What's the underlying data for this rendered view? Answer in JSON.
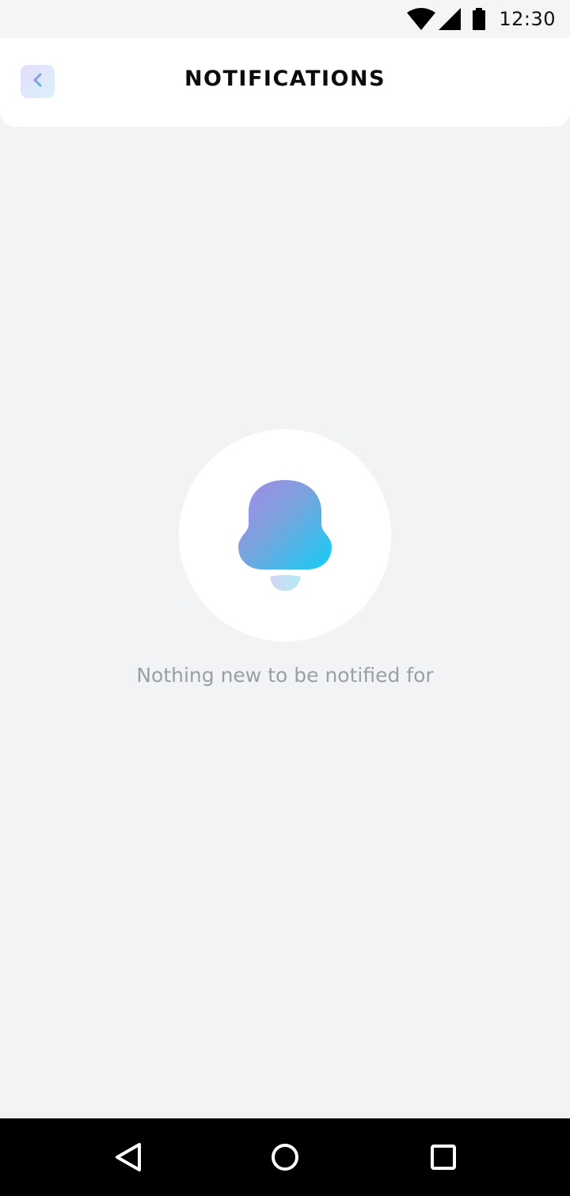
{
  "status_bar": {
    "time": "12:30",
    "icons": [
      "wifi-icon",
      "cellular-signal-icon",
      "battery-icon"
    ]
  },
  "header": {
    "title": "NOTIFICATIONS",
    "back_icon": "chevron-left-icon"
  },
  "empty_state": {
    "icon": "bell-icon",
    "message": "Nothing new to be notified for"
  },
  "nav_bar": {
    "icons": [
      "back-triangle-icon",
      "home-circle-icon",
      "recents-square-icon"
    ]
  },
  "colors": {
    "background": "#f2f3f5",
    "surface": "#ffffff",
    "title": "#0c0c0c",
    "muted_text": "#9a9ea6",
    "accent_purple": "#a38be8",
    "accent_cyan": "#1cc9f2"
  }
}
